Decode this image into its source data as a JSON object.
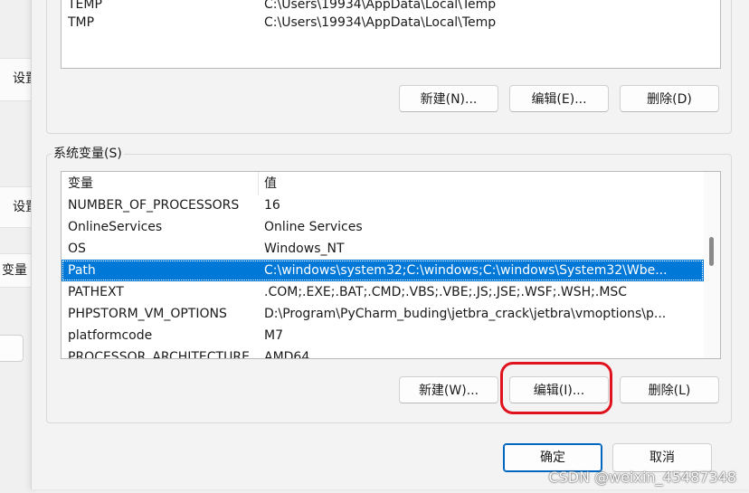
{
  "background_window": {
    "labels": [
      "设置",
      "设置",
      "变量"
    ]
  },
  "user_vars": {
    "rows": [
      {
        "name": "TEMP",
        "value": "C:\\Users\\19934\\AppData\\Local\\Temp"
      },
      {
        "name": "TMP",
        "value": "C:\\Users\\19934\\AppData\\Local\\Temp"
      }
    ],
    "new_label": "新建(N)...",
    "edit_label": "编辑(E)...",
    "delete_label": "删除(D)"
  },
  "system_vars": {
    "group_label": "系统变量(S)",
    "header_name": "变量",
    "header_value": "值",
    "rows": [
      {
        "name": "NUMBER_OF_PROCESSORS",
        "value": "16"
      },
      {
        "name": "OnlineServices",
        "value": "Online Services"
      },
      {
        "name": "OS",
        "value": "Windows_NT"
      },
      {
        "name": "Path",
        "value": "C:\\windows\\system32;C:\\windows;C:\\windows\\System32\\Wbe...",
        "selected": true
      },
      {
        "name": "PATHEXT",
        "value": ".COM;.EXE;.BAT;.CMD;.VBS;.VBE;.JS;.JSE;.WSF;.WSH;.MSC"
      },
      {
        "name": "PHPSTORM_VM_OPTIONS",
        "value": "D:\\Program\\PyCharm_buding\\jetbra_crack\\jetbra\\vmoptions\\p..."
      },
      {
        "name": "platformcode",
        "value": "M7"
      },
      {
        "name": "PROCESSOR_ARCHITECTURE",
        "value": "AMD64"
      }
    ],
    "new_label": "新建(W)...",
    "edit_label": "编辑(I)...",
    "delete_label": "删除(L)"
  },
  "footer": {
    "ok_label": "确定",
    "cancel_label": "取消"
  },
  "watermark": "CSDN @weixin_45487348",
  "colors": {
    "selection": "#0078d7",
    "highlight": "#e0121e",
    "primary_border": "#0067c0"
  }
}
